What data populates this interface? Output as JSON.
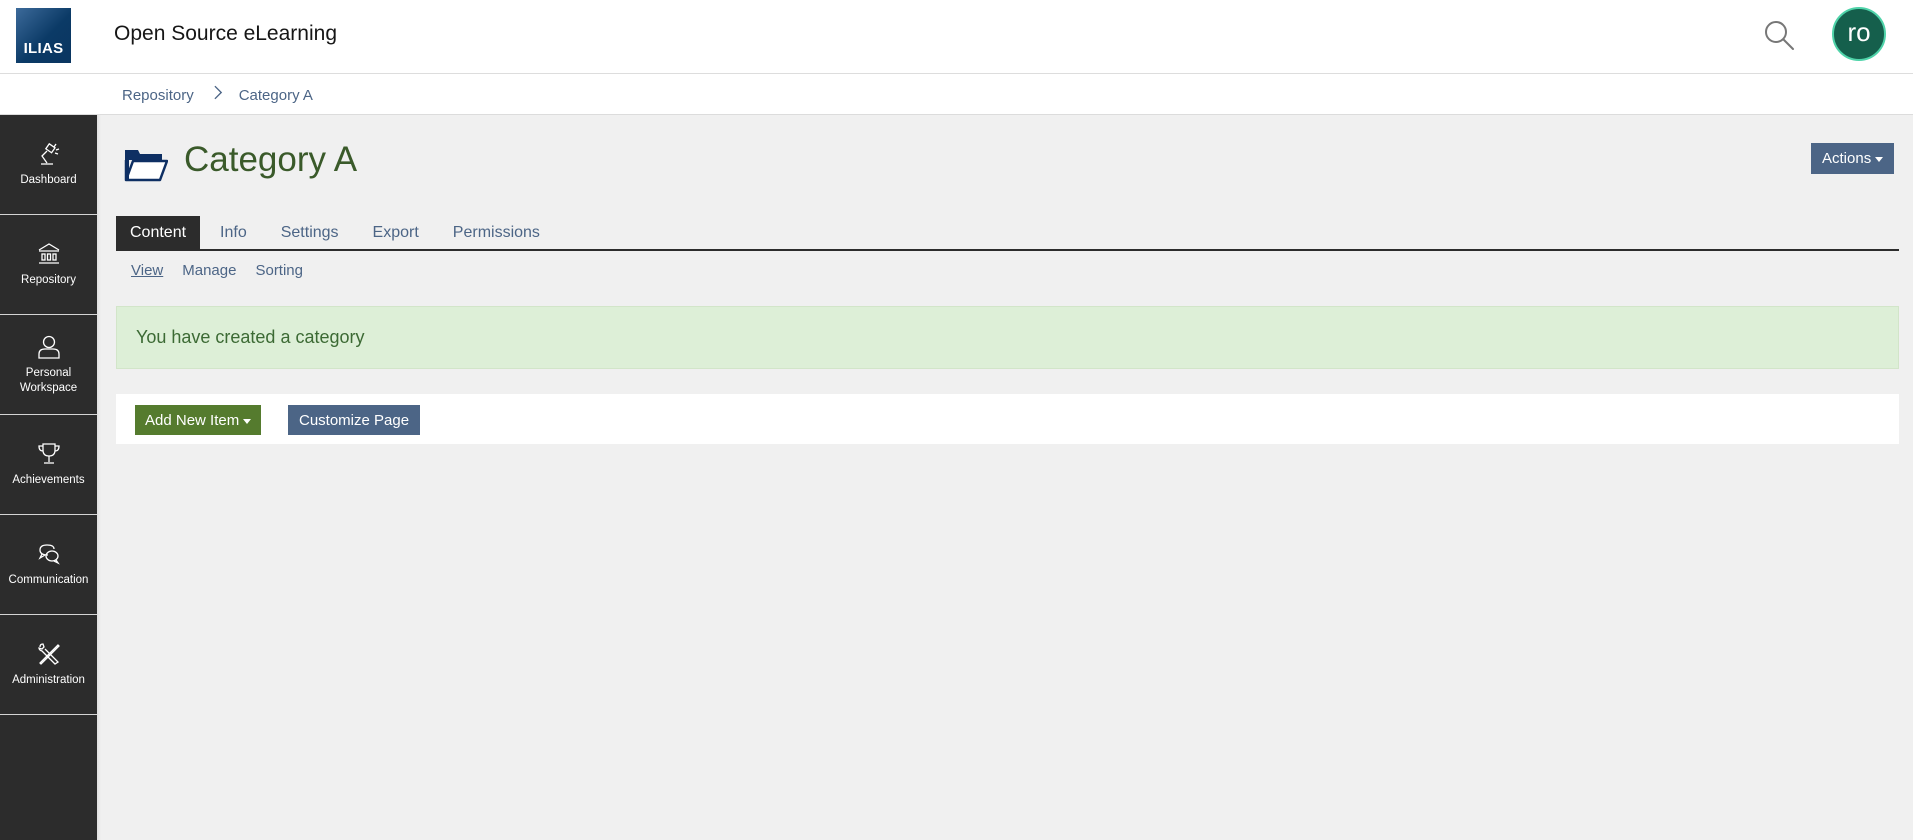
{
  "header": {
    "logo_text": "ILIAS",
    "site_title": "Open Source eLearning",
    "search_icon": "search-icon",
    "avatar_initials": "ro"
  },
  "breadcrumb": {
    "items": [
      {
        "label": "Repository"
      },
      {
        "label": "Category A"
      }
    ],
    "separator_icon": "chevron-right-icon"
  },
  "sidebar": {
    "items": [
      {
        "label": "Dashboard",
        "icon": "desk-lamp-icon"
      },
      {
        "label": "Repository",
        "icon": "bank-building-icon"
      },
      {
        "label": "Personal Workspace",
        "icon": "user-icon"
      },
      {
        "label": "Achievements",
        "icon": "trophy-icon"
      },
      {
        "label": "Communication",
        "icon": "chat-bubbles-icon"
      },
      {
        "label": "Administration",
        "icon": "tools-icon"
      }
    ]
  },
  "page": {
    "icon": "folder-icon",
    "title": "Category A",
    "actions_label": "Actions"
  },
  "tabs": [
    {
      "label": "Content",
      "active": true
    },
    {
      "label": "Info"
    },
    {
      "label": "Settings"
    },
    {
      "label": "Export"
    },
    {
      "label": "Permissions"
    }
  ],
  "subtabs": [
    {
      "label": "View",
      "active": true
    },
    {
      "label": "Manage"
    },
    {
      "label": "Sorting"
    }
  ],
  "message": {
    "type": "success",
    "text": "You have created a category"
  },
  "toolbar": {
    "add_new_item_label": "Add New Item",
    "customize_page_label": "Customize Page"
  },
  "colors": {
    "primary": "#4c6586",
    "success_button": "#557b2e",
    "title_green": "#3a5a2a",
    "sidebar_bg": "#2c2c2c",
    "success_msg_bg": "#ddefd7",
    "avatar_bg": "#155f4c"
  }
}
